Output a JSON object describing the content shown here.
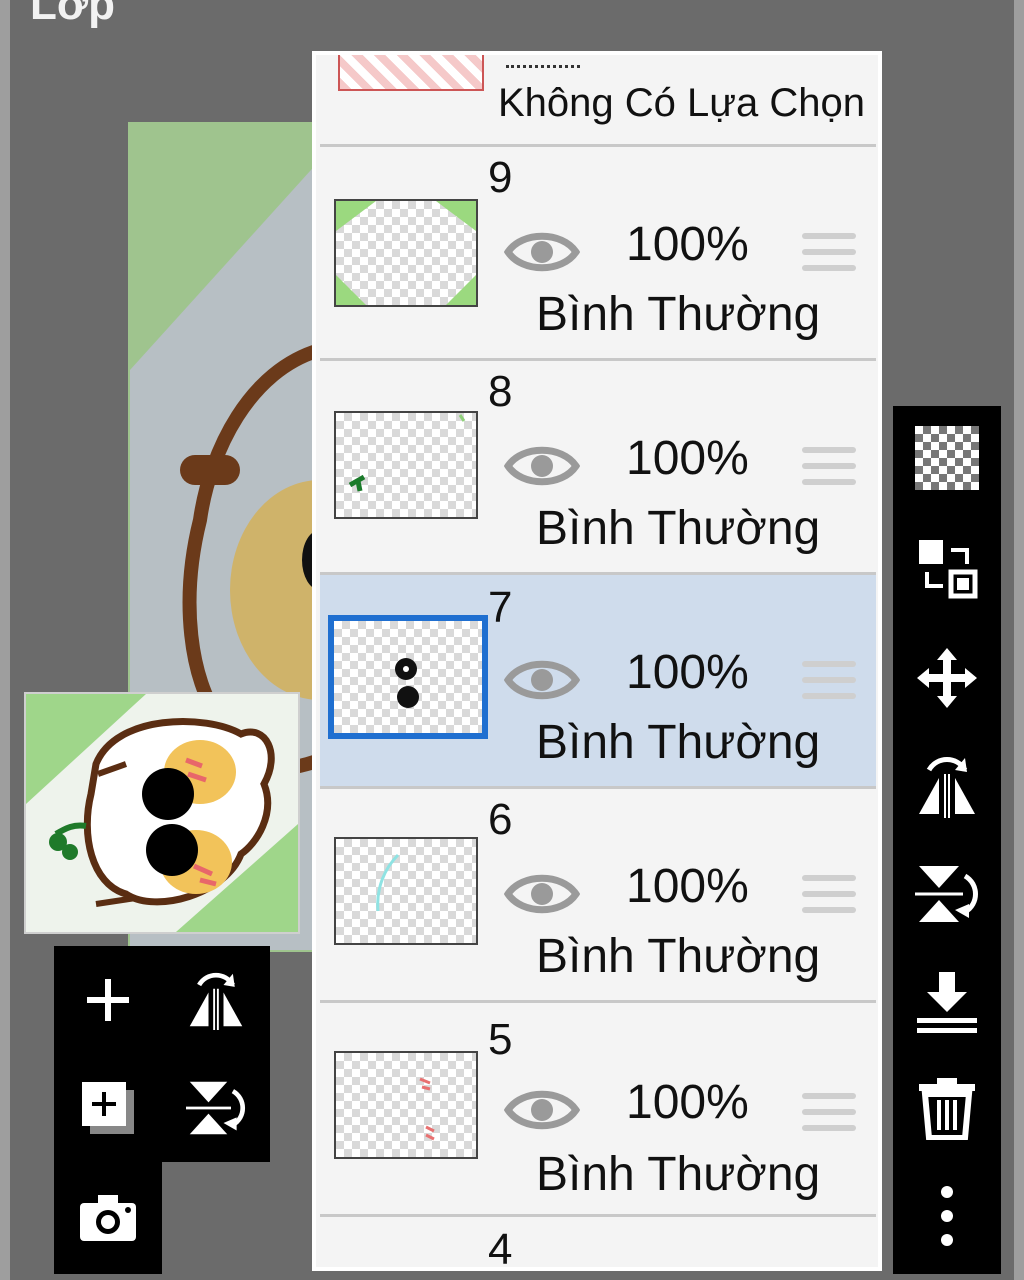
{
  "app": {
    "title": "Lớp"
  },
  "panel": {
    "top_partial_label": "Không Có Lựa Chọn",
    "layers": [
      {
        "number": "9",
        "opacity": "100%",
        "blend_mode": "Bình Thường",
        "selected": false
      },
      {
        "number": "8",
        "opacity": "100%",
        "blend_mode": "Bình Thường",
        "selected": false
      },
      {
        "number": "7",
        "opacity": "100%",
        "blend_mode": "Bình Thường",
        "selected": true
      },
      {
        "number": "6",
        "opacity": "100%",
        "blend_mode": "Bình Thường",
        "selected": false
      },
      {
        "number": "5",
        "opacity": "100%",
        "blend_mode": "Bình Thường",
        "selected": false
      },
      {
        "number": "4"
      }
    ]
  },
  "toolbar": {
    "icons": [
      "transparency-icon",
      "swap-layers-icon",
      "move-icon",
      "flip-horizontal-icon",
      "flip-vertical-icon",
      "merge-down-icon",
      "trash-icon",
      "more-icon"
    ]
  },
  "tools": {
    "icons": [
      "add-layer-icon",
      "flip-horizontal-icon",
      "add-layer-copy-icon",
      "flip-vertical-icon",
      "camera-icon"
    ]
  },
  "colors": {
    "selected_row": "#cfdcec",
    "selected_border": "#1f6fd0",
    "toolbar_bg": "#000000"
  }
}
